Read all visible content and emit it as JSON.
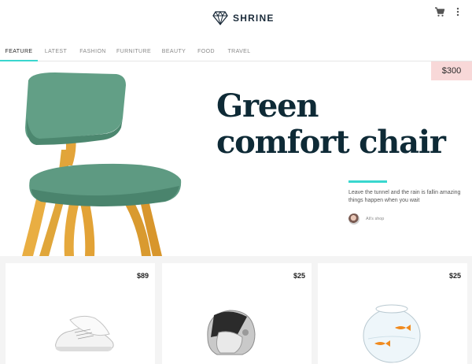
{
  "app": {
    "brand": "SHRINE"
  },
  "tabs": [
    "FEATURE",
    "LATEST",
    "FASHION",
    "FURNITURE",
    "BEAUTY",
    "FOOD",
    "TRAVEL"
  ],
  "hero": {
    "price": "$300",
    "title_line1": "Green",
    "title_line2": "comfort chair",
    "description": "Leave the tunnel and the rain is fallin amazing things happen when you wait",
    "shop": "Ali's shop"
  },
  "products": [
    {
      "price": "$89",
      "image": "sneakers"
    },
    {
      "price": "$25",
      "image": "helmet"
    },
    {
      "price": "$25",
      "image": "fishbowl"
    }
  ],
  "colors": {
    "accent": "#39d7cf",
    "badge": "#f8d8d8",
    "title": "#0e2a36"
  }
}
